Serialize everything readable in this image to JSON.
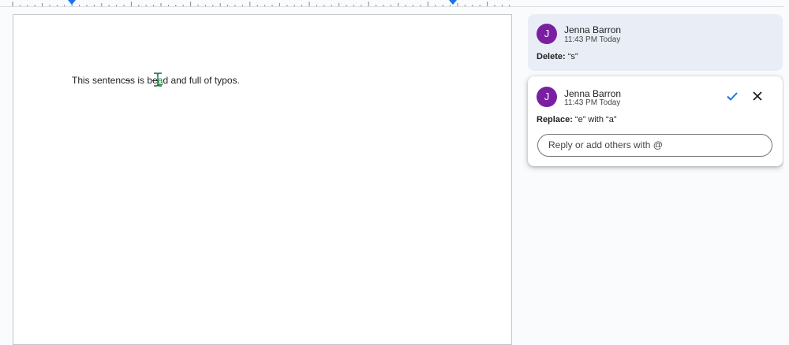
{
  "document": {
    "text_before": "This sentenc",
    "deleted_char": "e",
    "text_mid1": "s is b",
    "deleted_char2": "e",
    "inserted_char": "a",
    "text_after": "d and full of typos."
  },
  "comments": [
    {
      "author": "Jenna Barron",
      "avatar_letter": "J",
      "time": "11:43 PM Today",
      "action_label": "Delete:",
      "action_detail": " “s”"
    },
    {
      "author": "Jenna Barron",
      "avatar_letter": "J",
      "time": "11:43 PM Today",
      "action_label": "Replace:",
      "action_detail": " “e” with “a”",
      "reply_placeholder": "Reply or add others with @"
    }
  ],
  "colors": {
    "avatar": "#7b1fa2",
    "accept_check": "#1a73e8",
    "selected_card": "#e9eef6",
    "ruler_marker": "#1a73e8"
  }
}
